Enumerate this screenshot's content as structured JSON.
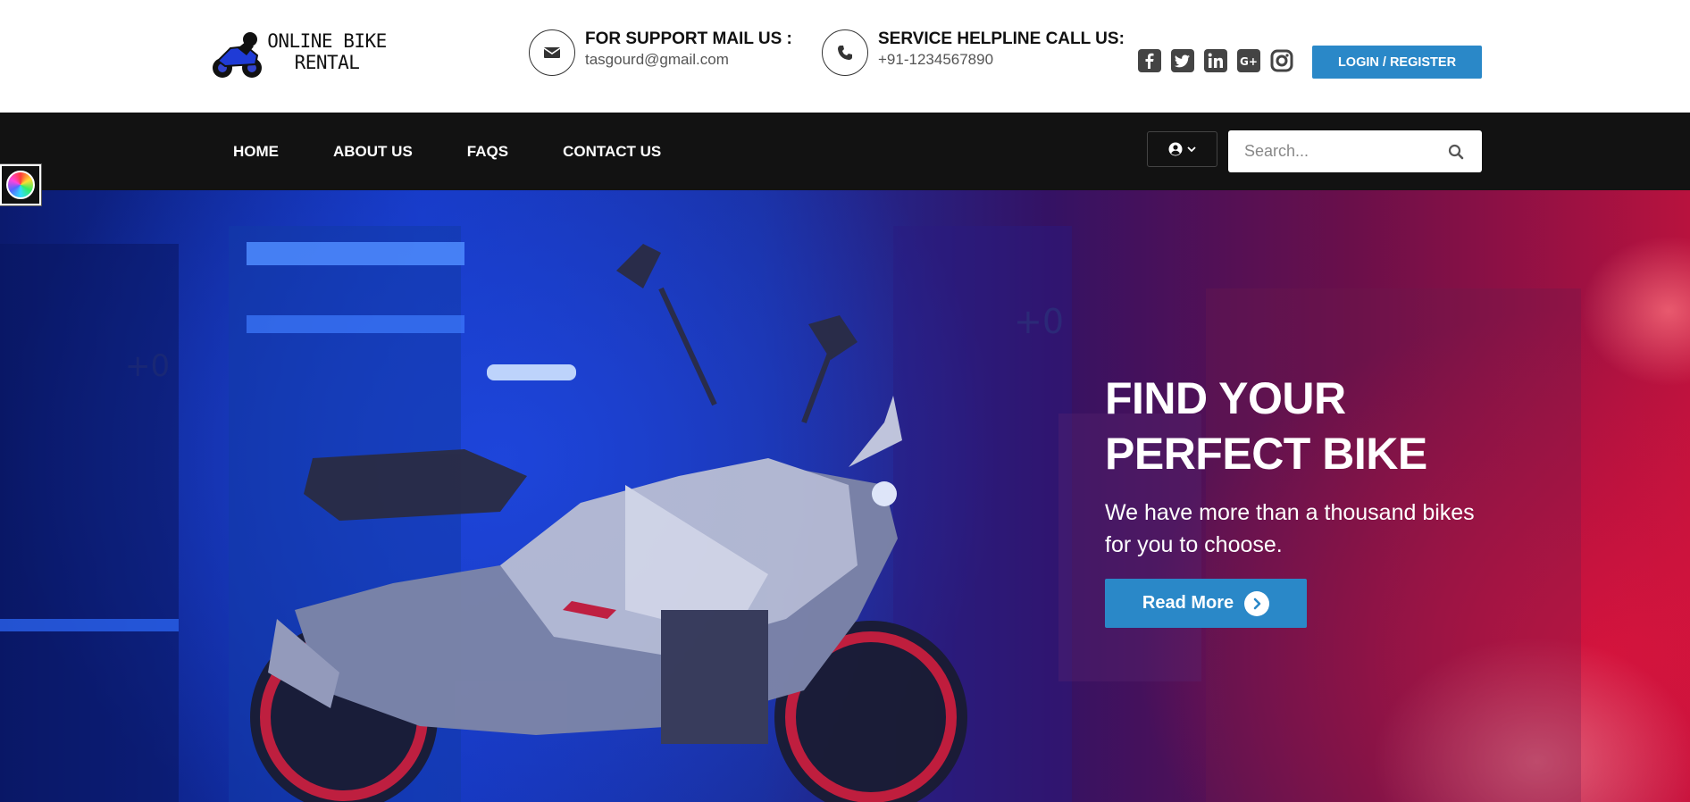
{
  "header": {
    "logo_text": "ONLINE BIKE RENTAL",
    "support": {
      "title": "FOR SUPPORT MAIL US :",
      "value": "tasgourd@gmail.com",
      "icon": "envelope-icon"
    },
    "helpline": {
      "title": "SERVICE HELPLINE CALL US:",
      "value": "+91-1234567890",
      "icon": "phone-icon"
    },
    "socials": [
      "facebook-icon",
      "twitter-icon",
      "linkedin-icon",
      "google-plus-icon",
      "instagram-icon"
    ],
    "login_label": "LOGIN / REGISTER"
  },
  "nav": {
    "items": [
      {
        "label": "HOME"
      },
      {
        "label": "ABOUT US"
      },
      {
        "label": "FAQS"
      },
      {
        "label": "CONTACT US"
      }
    ],
    "user_menu_icon": "user-circle-icon",
    "search_placeholder": "Search..."
  },
  "hero": {
    "headline_line1": "FIND YOUR",
    "headline_line2": "PERFECT BIKE",
    "subtitle": "We have more than a thousand bikes for you to choose.",
    "button_label": "Read More"
  },
  "colors": {
    "accent": "#2a88c8",
    "nav_bg": "#121212",
    "hero_blue": "#1437c0",
    "hero_red": "#b8123e"
  }
}
